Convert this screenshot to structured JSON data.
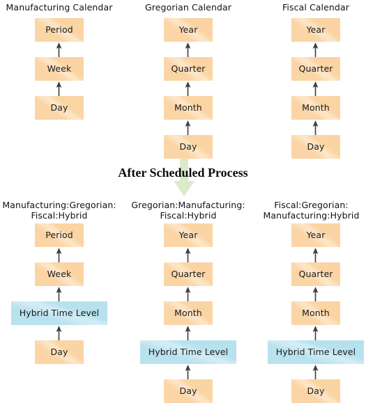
{
  "diagram": {
    "section_heading": "After Scheduled Process",
    "big_arrow_icon": "down-arrow-icon",
    "arrow_icon": "up-arrow-icon",
    "accent_colors": {
      "node_orange": "#FBD5A6",
      "node_blue": "#B8E2EE",
      "big_arrow_green": "#DDEBCB",
      "arrow_stroke": "#3C3C3C",
      "background": "#FFFFFF"
    },
    "before": {
      "columns": [
        {
          "title": "Manufacturing Calendar",
          "nodes": [
            {
              "label": "Period",
              "type": "orange"
            },
            {
              "label": "Week",
              "type": "orange"
            },
            {
              "label": "Day",
              "type": "orange"
            }
          ]
        },
        {
          "title": "Gregorian Calendar",
          "nodes": [
            {
              "label": "Year",
              "type": "orange"
            },
            {
              "label": "Quarter",
              "type": "orange"
            },
            {
              "label": "Month",
              "type": "orange"
            },
            {
              "label": "Day",
              "type": "orange"
            }
          ]
        },
        {
          "title": "Fiscal Calendar",
          "nodes": [
            {
              "label": "Year",
              "type": "orange"
            },
            {
              "label": "Quarter",
              "type": "orange"
            },
            {
              "label": "Month",
              "type": "orange"
            },
            {
              "label": "Day",
              "type": "orange"
            }
          ]
        }
      ]
    },
    "after": {
      "columns": [
        {
          "title": "Manufacturing:Gregorian:\nFiscal:Hybrid",
          "nodes": [
            {
              "label": "Period",
              "type": "orange"
            },
            {
              "label": "Week",
              "type": "orange"
            },
            {
              "label": "Hybrid Time Level",
              "type": "blue"
            },
            {
              "label": "Day",
              "type": "orange"
            }
          ]
        },
        {
          "title": "Gregorian:Manufacturing:\nFiscal:Hybrid",
          "nodes": [
            {
              "label": "Year",
              "type": "orange"
            },
            {
              "label": "Quarter",
              "type": "orange"
            },
            {
              "label": "Month",
              "type": "orange"
            },
            {
              "label": "Hybrid Time Level",
              "type": "blue"
            },
            {
              "label": "Day",
              "type": "orange"
            }
          ]
        },
        {
          "title": "Fiscal:Gregorian:\nManufacturing:Hybrid",
          "nodes": [
            {
              "label": "Year",
              "type": "orange"
            },
            {
              "label": "Quarter",
              "type": "orange"
            },
            {
              "label": "Month",
              "type": "orange"
            },
            {
              "label": "Hybrid Time Level",
              "type": "blue"
            },
            {
              "label": "Day",
              "type": "orange"
            }
          ]
        }
      ]
    }
  }
}
